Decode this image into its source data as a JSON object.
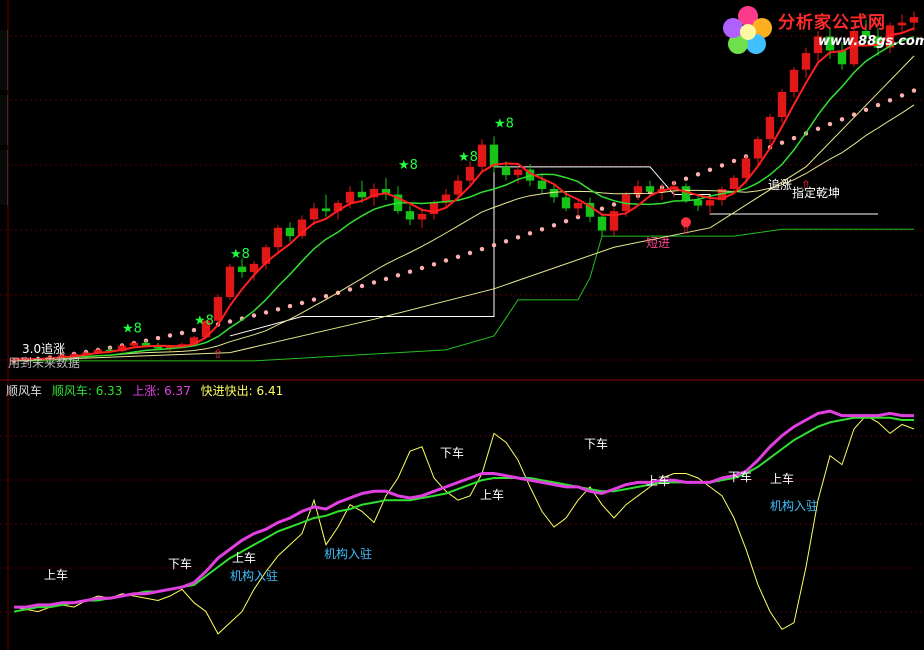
{
  "logo": {
    "text": "分析家公式网",
    "url": "www.88gs.com"
  },
  "colors": {
    "bg": "#000000",
    "up": "#e01818",
    "down": "#18c418",
    "ma_red": "#ff2020",
    "ma_green": "#30e030",
    "ma_yellow": "#e8e890",
    "dots": "#ffb0b0",
    "box": "#ffffff",
    "grid": "#5a0000",
    "mag": "#e040e0",
    "yellow": "#ffff60",
    "cyan": "#40c0ff",
    "label_green": "#20ff40",
    "label_white": "#ffffff"
  },
  "main_labels": {
    "zhuizhang_30": "3.0追涨",
    "future_data": "用到未来数据",
    "duanjin": "短进",
    "zhuizhang": "追涨",
    "zhiding": "指定乾坤",
    "s8": "8",
    "s8_small": "S"
  },
  "indicator": {
    "name": "顺风车",
    "items": [
      {
        "label": "顺风车: 6.33",
        "color": "#30e030"
      },
      {
        "label": "上涨: 6.37",
        "color": "#e040e0"
      },
      {
        "label": "快进快出: 6.41",
        "color": "#ffff60"
      }
    ],
    "labels": {
      "shangche": "上车",
      "xiache": "下车",
      "jigou": "机构入驻"
    }
  },
  "chart_data": [
    {
      "type": "candlestick",
      "title": "",
      "x_count": 76,
      "candles": [
        [
          1.0,
          1.02,
          0.99,
          1.01
        ],
        [
          1.01,
          1.03,
          1.0,
          1.02
        ],
        [
          1.02,
          1.03,
          1.0,
          1.01
        ],
        [
          1.01,
          1.04,
          1.0,
          1.03
        ],
        [
          1.03,
          1.05,
          1.02,
          1.04
        ],
        [
          1.04,
          1.06,
          1.03,
          1.05
        ],
        [
          1.05,
          1.07,
          1.04,
          1.06
        ],
        [
          1.06,
          1.09,
          1.05,
          1.08
        ],
        [
          1.08,
          1.1,
          1.06,
          1.07
        ],
        [
          1.07,
          1.12,
          1.06,
          1.11
        ],
        [
          1.11,
          1.14,
          1.09,
          1.13
        ],
        [
          1.13,
          1.15,
          1.1,
          1.11
        ],
        [
          1.11,
          1.13,
          1.08,
          1.09
        ],
        [
          1.09,
          1.11,
          1.07,
          1.1
        ],
        [
          1.1,
          1.13,
          1.09,
          1.12
        ],
        [
          1.12,
          1.18,
          1.11,
          1.17
        ],
        [
          1.17,
          1.3,
          1.16,
          1.29
        ],
        [
          1.29,
          1.48,
          1.28,
          1.46
        ],
        [
          1.46,
          1.7,
          1.44,
          1.68
        ],
        [
          1.68,
          1.74,
          1.6,
          1.64
        ],
        [
          1.64,
          1.72,
          1.58,
          1.7
        ],
        [
          1.7,
          1.84,
          1.66,
          1.82
        ],
        [
          1.82,
          1.98,
          1.78,
          1.96
        ],
        [
          1.96,
          2.0,
          1.86,
          1.9
        ],
        [
          1.9,
          2.05,
          1.88,
          2.02
        ],
        [
          2.02,
          2.14,
          1.98,
          2.1
        ],
        [
          2.1,
          2.2,
          2.04,
          2.08
        ],
        [
          2.08,
          2.16,
          2.02,
          2.14
        ],
        [
          2.14,
          2.26,
          2.1,
          2.22
        ],
        [
          2.22,
          2.3,
          2.14,
          2.18
        ],
        [
          2.18,
          2.28,
          2.12,
          2.24
        ],
        [
          2.24,
          2.32,
          2.16,
          2.2
        ],
        [
          2.2,
          2.26,
          2.06,
          2.08
        ],
        [
          2.08,
          2.12,
          1.98,
          2.02
        ],
        [
          2.02,
          2.1,
          1.96,
          2.06
        ],
        [
          2.06,
          2.16,
          2.02,
          2.14
        ],
        [
          2.14,
          2.24,
          2.1,
          2.2
        ],
        [
          2.2,
          2.34,
          2.16,
          2.3
        ],
        [
          2.3,
          2.44,
          2.26,
          2.4
        ],
        [
          2.4,
          2.6,
          2.36,
          2.56
        ],
        [
          2.56,
          2.62,
          2.36,
          2.4
        ],
        [
          2.4,
          2.44,
          2.3,
          2.34
        ],
        [
          2.34,
          2.4,
          2.28,
          2.38
        ],
        [
          2.38,
          2.42,
          2.26,
          2.3
        ],
        [
          2.3,
          2.34,
          2.2,
          2.24
        ],
        [
          2.24,
          2.28,
          2.14,
          2.18
        ],
        [
          2.18,
          2.22,
          2.08,
          2.1
        ],
        [
          2.1,
          2.16,
          2.04,
          2.14
        ],
        [
          2.14,
          2.18,
          2.0,
          2.04
        ],
        [
          2.04,
          2.06,
          1.9,
          1.94
        ],
        [
          1.94,
          2.1,
          1.9,
          2.08
        ],
        [
          2.08,
          2.22,
          2.04,
          2.2
        ],
        [
          2.2,
          2.3,
          2.16,
          2.26
        ],
        [
          2.26,
          2.3,
          2.18,
          2.22
        ],
        [
          2.22,
          2.28,
          2.16,
          2.24
        ],
        [
          2.24,
          2.3,
          2.18,
          2.26
        ],
        [
          2.26,
          2.28,
          2.14,
          2.16
        ],
        [
          2.16,
          2.2,
          2.08,
          2.12
        ],
        [
          2.12,
          2.18,
          2.06,
          2.16
        ],
        [
          2.16,
          2.26,
          2.12,
          2.24
        ],
        [
          2.24,
          2.34,
          2.2,
          2.32
        ],
        [
          2.32,
          2.48,
          2.28,
          2.46
        ],
        [
          2.46,
          2.62,
          2.42,
          2.6
        ],
        [
          2.6,
          2.78,
          2.56,
          2.76
        ],
        [
          2.76,
          2.96,
          2.72,
          2.94
        ],
        [
          2.94,
          3.12,
          2.9,
          3.1
        ],
        [
          3.1,
          3.26,
          3.04,
          3.22
        ],
        [
          3.22,
          3.38,
          3.16,
          3.34
        ],
        [
          3.34,
          3.4,
          3.18,
          3.24
        ],
        [
          3.24,
          3.3,
          3.1,
          3.14
        ],
        [
          3.14,
          3.4,
          3.12,
          3.38
        ],
        [
          3.38,
          3.46,
          3.3,
          3.34
        ],
        [
          3.34,
          3.4,
          3.2,
          3.26
        ],
        [
          3.26,
          3.44,
          3.22,
          3.42
        ],
        [
          3.42,
          3.5,
          3.36,
          3.44
        ],
        [
          3.44,
          3.52,
          3.38,
          3.48
        ]
      ],
      "ylim": [
        0.92,
        3.56
      ]
    },
    {
      "type": "line",
      "title": "",
      "series": [
        {
          "name": "顺风车",
          "values": [
            0.1,
            0.11,
            0.12,
            0.12,
            0.13,
            0.14,
            0.15,
            0.15,
            0.16,
            0.17,
            0.18,
            0.19,
            0.19,
            0.2,
            0.21,
            0.22,
            0.26,
            0.3,
            0.34,
            0.37,
            0.4,
            0.43,
            0.46,
            0.48,
            0.5,
            0.52,
            0.53,
            0.55,
            0.56,
            0.58,
            0.59,
            0.6,
            0.6,
            0.6,
            0.61,
            0.62,
            0.63,
            0.65,
            0.67,
            0.69,
            0.7,
            0.7,
            0.7,
            0.7,
            0.69,
            0.68,
            0.67,
            0.66,
            0.65,
            0.64,
            0.64,
            0.65,
            0.66,
            0.67,
            0.68,
            0.68,
            0.68,
            0.68,
            0.68,
            0.69,
            0.7,
            0.72,
            0.75,
            0.79,
            0.83,
            0.87,
            0.9,
            0.93,
            0.95,
            0.96,
            0.97,
            0.97,
            0.97,
            0.97,
            0.96,
            0.96
          ]
        },
        {
          "name": "上涨",
          "values": [
            0.12,
            0.12,
            0.13,
            0.13,
            0.14,
            0.14,
            0.15,
            0.16,
            0.16,
            0.17,
            0.18,
            0.18,
            0.19,
            0.2,
            0.21,
            0.23,
            0.28,
            0.34,
            0.38,
            0.42,
            0.45,
            0.47,
            0.5,
            0.52,
            0.55,
            0.57,
            0.56,
            0.59,
            0.61,
            0.63,
            0.64,
            0.64,
            0.62,
            0.61,
            0.62,
            0.64,
            0.66,
            0.68,
            0.7,
            0.72,
            0.72,
            0.71,
            0.7,
            0.69,
            0.68,
            0.67,
            0.66,
            0.66,
            0.64,
            0.63,
            0.65,
            0.67,
            0.68,
            0.68,
            0.69,
            0.69,
            0.68,
            0.68,
            0.68,
            0.7,
            0.71,
            0.73,
            0.78,
            0.84,
            0.89,
            0.93,
            0.96,
            0.99,
            1.0,
            0.98,
            0.98,
            0.98,
            0.98,
            0.99,
            0.98,
            0.98
          ]
        },
        {
          "name": "快进快出",
          "values": [
            0.12,
            0.11,
            0.1,
            0.12,
            0.13,
            0.12,
            0.15,
            0.17,
            0.16,
            0.18,
            0.17,
            0.16,
            0.15,
            0.17,
            0.2,
            0.14,
            0.1,
            0.0,
            0.05,
            0.1,
            0.2,
            0.28,
            0.35,
            0.4,
            0.45,
            0.6,
            0.4,
            0.48,
            0.58,
            0.55,
            0.5,
            0.62,
            0.7,
            0.82,
            0.84,
            0.7,
            0.64,
            0.6,
            0.62,
            0.72,
            0.9,
            0.86,
            0.78,
            0.66,
            0.55,
            0.48,
            0.52,
            0.6,
            0.66,
            0.58,
            0.52,
            0.58,
            0.62,
            0.66,
            0.7,
            0.72,
            0.72,
            0.7,
            0.66,
            0.62,
            0.52,
            0.38,
            0.22,
            0.1,
            0.02,
            0.05,
            0.3,
            0.6,
            0.8,
            0.76,
            0.92,
            0.98,
            0.95,
            0.9,
            0.94,
            0.92
          ]
        }
      ],
      "ylim": [
        -0.05,
        1.05
      ]
    }
  ]
}
